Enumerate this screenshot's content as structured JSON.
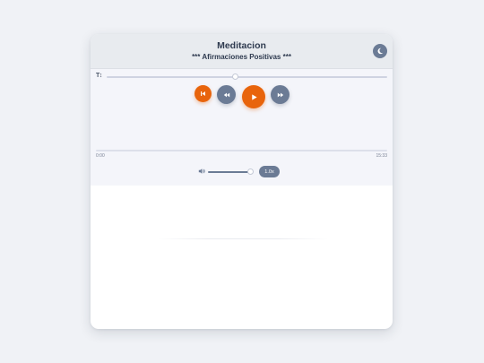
{
  "header": {
    "title": "Meditacion",
    "subtitle": "*** Afirmaciones Positivas ***",
    "theme_icon": "moon-icon"
  },
  "font_size": {
    "icon_label": "T↕",
    "level": 0.46
  },
  "controls": {
    "restart_icon": "skip-back-icon",
    "rewind_icon": "rewind-icon",
    "play_icon": "play-icon",
    "forward_icon": "fast-forward-icon"
  },
  "playback": {
    "current_time": "0:00",
    "duration": "15:33",
    "progress": 0
  },
  "volume": {
    "icon": "volume-icon",
    "level": 1.0
  },
  "speed": {
    "label": "1.0x"
  },
  "colors": {
    "accent": "#e8640c",
    "control": "#6b7b95",
    "text": "#2e3a4f",
    "header_bg": "#e8ebef",
    "page_bg": "#f0f2f6"
  }
}
